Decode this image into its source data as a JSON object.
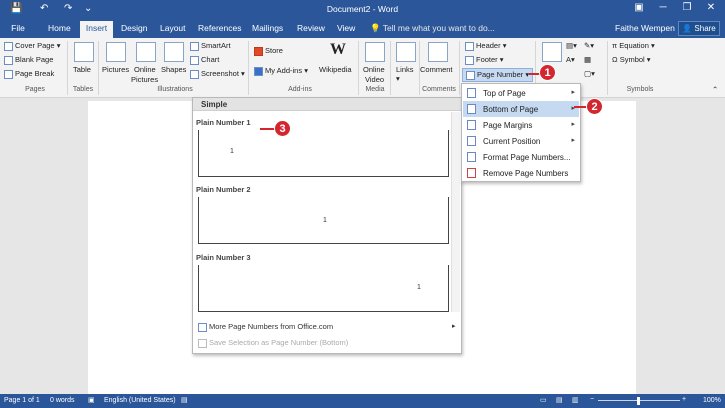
{
  "titlebar": {
    "title": "Document2 - Word",
    "undo": "↶",
    "redo": "↷",
    "save": "💾",
    "customize": "⌄",
    "ribbon_opts": "▣",
    "minimize": "─",
    "restore": "❐",
    "close": "✕"
  },
  "tabs": {
    "file": "File",
    "home": "Home",
    "insert": "Insert",
    "design": "Design",
    "layout": "Layout",
    "references": "References",
    "mailings": "Mailings",
    "review": "Review",
    "view": "View",
    "tellme": "Tell me what you want to do...",
    "user": "Faithe Wempen",
    "share": "Share"
  },
  "ribbon": {
    "pages": {
      "cover": "Cover Page",
      "blank": "Blank Page",
      "break": "Page Break",
      "label": "Pages"
    },
    "tables": {
      "table": "Table",
      "label": "Tables"
    },
    "illustrations": {
      "pictures": "Pictures",
      "online1": "Online",
      "online2": "Pictures",
      "shapes": "Shapes",
      "smartart": "SmartArt",
      "chart": "Chart",
      "screenshot": "Screenshot",
      "label": "Illustrations"
    },
    "addins": {
      "store": "Store",
      "myaddins": "My Add-ins",
      "wikipedia": "Wikipedia",
      "wiki_glyph": "W",
      "label": "Add-ins"
    },
    "media": {
      "video1": "Online",
      "video2": "Video",
      "label": "Media"
    },
    "links": {
      "links": "Links"
    },
    "comments": {
      "comment": "Comment",
      "label": "Comments"
    },
    "headerfooter": {
      "header": "Header",
      "footer": "Footer",
      "pagenumber": "Page Number"
    },
    "symbols": {
      "equation": "Equation",
      "symbol": "Symbol",
      "label": "Symbols",
      "pi": "π",
      "omega": "Ω"
    }
  },
  "gallery": {
    "section": "Simple",
    "items": [
      {
        "label": "Plain Number 1",
        "mark": "1"
      },
      {
        "label": "Plain Number 2",
        "mark": "1"
      },
      {
        "label": "Plain Number 3",
        "mark": "1"
      }
    ],
    "more": "More Page Numbers from Office.com",
    "save": "Save Selection as Page Number (Bottom)"
  },
  "submenu": {
    "items": [
      "Top of Page",
      "Bottom of Page",
      "Page Margins",
      "Current Position",
      "Format Page Numbers...",
      "Remove Page Numbers"
    ]
  },
  "callouts": [
    "1",
    "2",
    "3"
  ],
  "status": {
    "page": "Page 1 of 1",
    "words": "0 words",
    "language": "English (United States)",
    "zoom": "100%",
    "zoom_minus": "−",
    "zoom_plus": "+"
  }
}
